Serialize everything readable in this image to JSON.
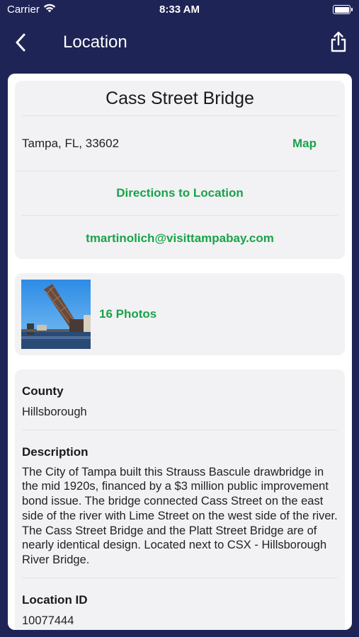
{
  "status": {
    "carrier": "Carrier",
    "time": "8:33 AM",
    "battery_level": 1.0
  },
  "nav": {
    "title": "Location",
    "back_icon": "chevron-left-icon",
    "share_icon": "share-icon"
  },
  "place": {
    "name": "Cass Street Bridge",
    "address": "Tampa, FL, 33602",
    "map_link": "Map",
    "directions_link": "Directions to Location",
    "email": "tmartinolich@visittampabay.com"
  },
  "photos": {
    "label": "16 Photos"
  },
  "details": {
    "county_label": "County",
    "county_value": "Hillsborough",
    "description_label": "Description",
    "description_value": "The City of Tampa built this Strauss Bascule drawbridge in the mid 1920s, financed by a $3 million public improvement bond issue. The bridge connected Cass Street on the east side of the river with Lime Street on the west side of the river. The Cass Street Bridge and the Platt Street Bridge are of nearly identical design. Located next to CSX - Hillsborough River Bridge.",
    "location_id_label": "Location ID",
    "location_id_value": "10077444"
  },
  "colors": {
    "nav_background": "#1f2456",
    "link_green": "#1aa34a",
    "card_background": "#f2f2f4"
  }
}
